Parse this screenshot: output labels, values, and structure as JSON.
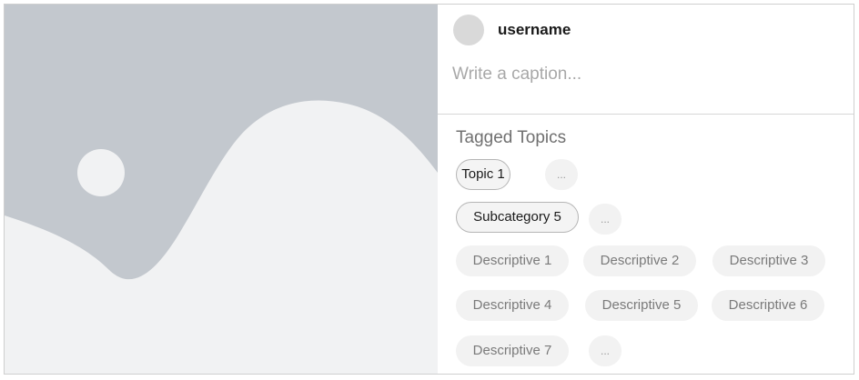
{
  "post": {
    "username": "username",
    "caption_placeholder": "Write a caption..."
  },
  "topics": {
    "title": "Tagged Topics",
    "topic_chips": [
      "Topic 1",
      "Subcategory 5"
    ],
    "more_label": "...",
    "descriptive_chips": [
      "Descriptive 1",
      "Descriptive 2",
      "Descriptive 3",
      "Descriptive 4",
      "Descriptive 5",
      "Descriptive 6",
      "Descriptive 7"
    ]
  },
  "colors": {
    "image_placeholder_bg": "#c3c8ce",
    "image_placeholder_fg": "#f1f2f3",
    "chip_bg": "#f2f2f2",
    "selected_chip_border": "#b5b5b5"
  }
}
